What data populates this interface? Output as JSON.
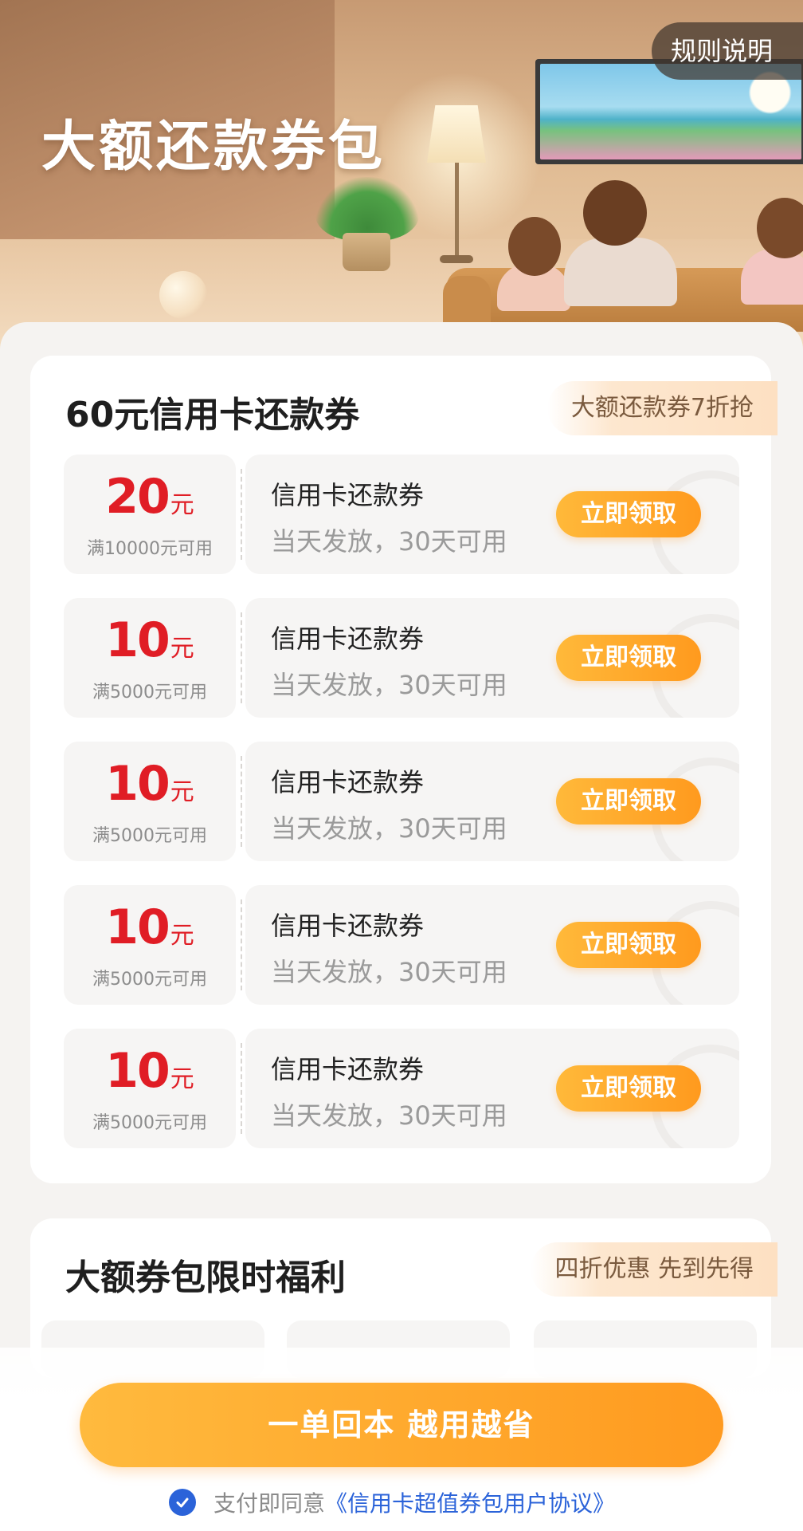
{
  "hero": {
    "title": "大额还款券包",
    "rules_button": "规则说明"
  },
  "section1": {
    "title": "60元信用卡还款券",
    "tag": "大额还款券7折抢",
    "coupons": [
      {
        "amount": "20",
        "unit": "元",
        "condition": "满10000元可用",
        "name": "信用卡还款券",
        "desc": "当天发放，30天可用",
        "button": "立即领取"
      },
      {
        "amount": "10",
        "unit": "元",
        "condition": "满5000元可用",
        "name": "信用卡还款券",
        "desc": "当天发放，30天可用",
        "button": "立即领取"
      },
      {
        "amount": "10",
        "unit": "元",
        "condition": "满5000元可用",
        "name": "信用卡还款券",
        "desc": "当天发放，30天可用",
        "button": "立即领取"
      },
      {
        "amount": "10",
        "unit": "元",
        "condition": "满5000元可用",
        "name": "信用卡还款券",
        "desc": "当天发放，30天可用",
        "button": "立即领取"
      },
      {
        "amount": "10",
        "unit": "元",
        "condition": "满5000元可用",
        "name": "信用卡还款券",
        "desc": "当天发放，30天可用",
        "button": "立即领取"
      }
    ]
  },
  "section2": {
    "title": "大额券包限时福利",
    "tag": "四折优惠 先到先得"
  },
  "footer": {
    "cta": "一单回本 越用越省",
    "agree_prefix": "支付即同意",
    "agreement_link": "《信用卡超值券包用户协议》"
  },
  "colors": {
    "accent_orange": "#ff9a1e",
    "amount_red": "#e01d25",
    "link_blue": "#2b63d9"
  },
  "icons": {
    "agree_check": "check-circle-icon"
  }
}
